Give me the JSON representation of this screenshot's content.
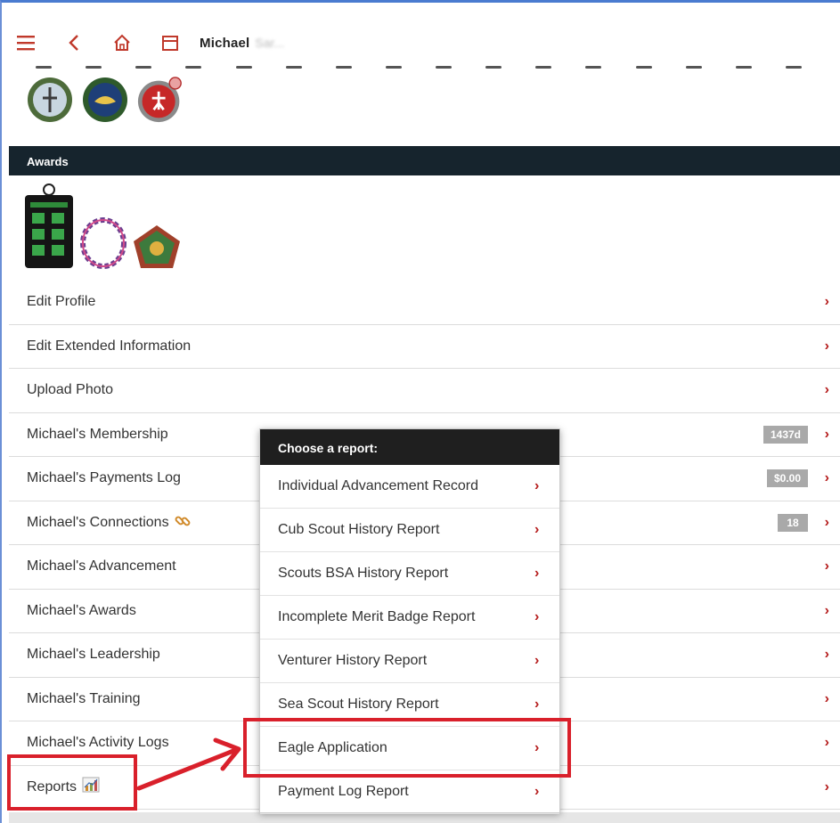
{
  "header": {
    "name": "Michael",
    "name_obscured": "Sar..."
  },
  "section": {
    "awards_title": "Awards"
  },
  "menu": {
    "items": [
      {
        "label": "Edit Profile",
        "badge": null
      },
      {
        "label": "Edit Extended Information",
        "badge": null
      },
      {
        "label": "Upload Photo",
        "badge": null
      },
      {
        "label": "Michael's Membership",
        "badge": "1437d"
      },
      {
        "label": "Michael's Payments Log",
        "badge": "$0.00"
      },
      {
        "label": "Michael's Connections",
        "badge": "18"
      },
      {
        "label": "Michael's Advancement",
        "badge": null
      },
      {
        "label": "Michael's Awards",
        "badge": null
      },
      {
        "label": "Michael's Leadership",
        "badge": null
      },
      {
        "label": "Michael's Training",
        "badge": null
      },
      {
        "label": "Michael's Activity Logs",
        "badge": null
      },
      {
        "label": "Reports",
        "badge": null
      }
    ]
  },
  "dropdown": {
    "title": "Choose a report:",
    "items": [
      "Individual Advancement Record",
      "Cub Scout History Report",
      "Scouts BSA History Report",
      "Incomplete Merit Badge Report",
      "Venturer History Report",
      "Sea Scout History Report",
      "Eagle Application",
      "Payment Log Report"
    ]
  },
  "chevron": "›",
  "colors": {
    "accent_red": "#b51d1d",
    "header_bg": "#16242d",
    "highlight": "#d9202b"
  }
}
